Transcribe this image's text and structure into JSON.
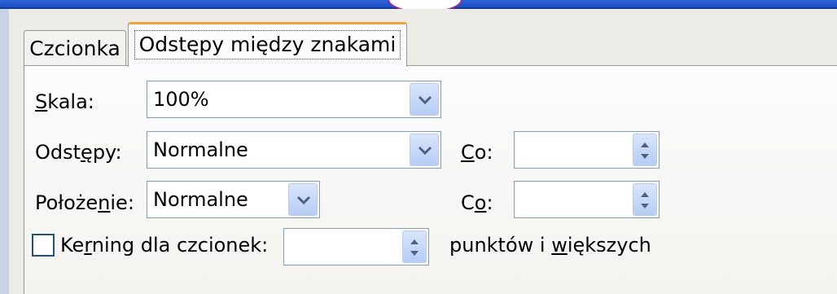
{
  "tabs": {
    "font": "Czcionka",
    "spacing": "Odstępy między znakami"
  },
  "fields": {
    "scale": {
      "label_pre": "",
      "label_mn": "S",
      "label_post": "kala:",
      "value": "100%"
    },
    "spacing": {
      "label_pre": "Odst",
      "label_mn": "ę",
      "label_post": "py:",
      "value": "Normalne",
      "by_label_mn": "C",
      "by_label_post": "o:",
      "by_value": ""
    },
    "position": {
      "label_pre": "Położe",
      "label_mn": "n",
      "label_post": "ie:",
      "value": "Normalne",
      "by_label_pre": "C",
      "by_label_mn": "o",
      "by_label_post": ":",
      "by_value": ""
    },
    "kerning": {
      "label_pre": "Ke",
      "label_mn": "r",
      "label_post": "ning dla czcionek:",
      "value": "",
      "checked": false,
      "suffix_pre": "punktów i ",
      "suffix_mn": "w",
      "suffix_post": "iększych"
    }
  },
  "icons": {
    "dropdown": "chevron-down-icon",
    "spinner": "spinner-arrows-icon"
  },
  "colors": {
    "title_bar": "#2f64d8",
    "active_tab_accent": "#f2a23c",
    "field_border": "#7f9db9"
  }
}
